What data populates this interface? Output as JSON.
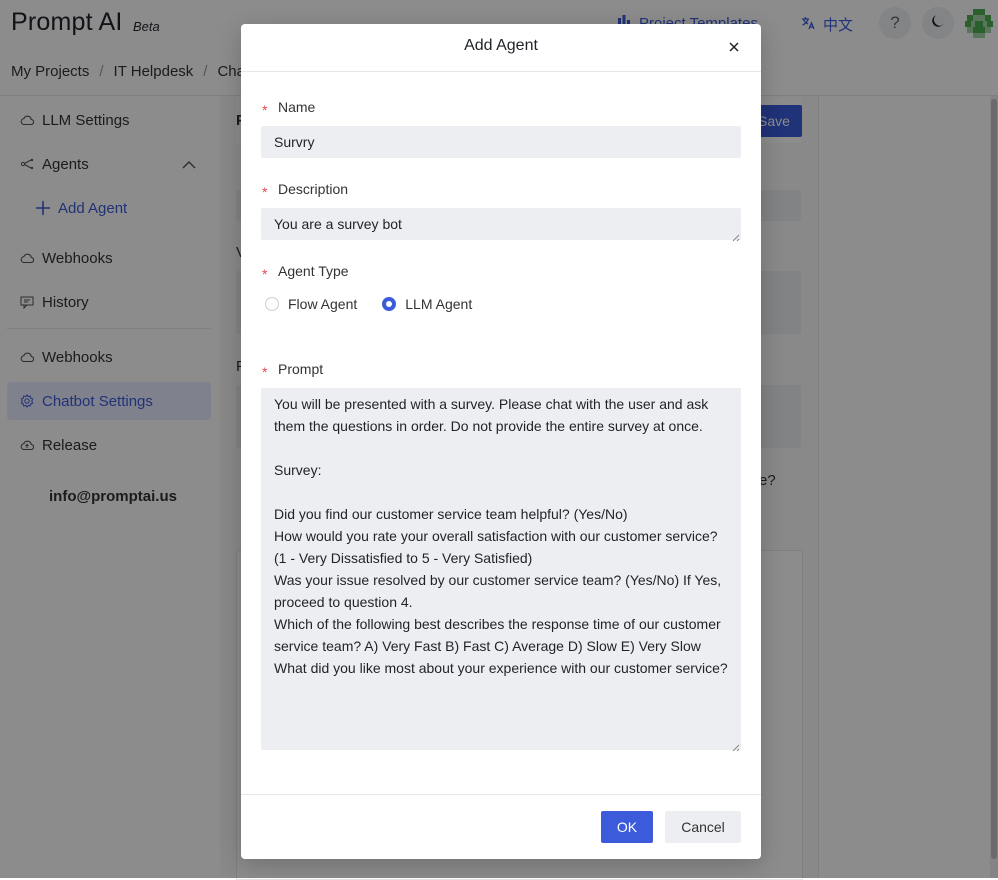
{
  "app": {
    "brand": "Prompt AI",
    "beta": "Beta",
    "project_templates": "Project Templates",
    "language": "中文",
    "help_icon": "?"
  },
  "breadcrumb": [
    "My Projects",
    "IT Helpdesk",
    "Chatb"
  ],
  "sidebar": {
    "items": [
      {
        "label": "LLM Settings",
        "icon": "cloud-icon"
      },
      {
        "label": "Agents",
        "icon": "agents-icon"
      },
      {
        "label": "Add Agent",
        "icon": "plus-icon"
      },
      {
        "label": "Webhooks",
        "icon": "cloud-icon"
      },
      {
        "label": "History",
        "icon": "history-icon"
      },
      {
        "label": "Webhooks",
        "icon": "cloud-icon"
      },
      {
        "label": "Chatbot Settings",
        "icon": "settings-icon"
      },
      {
        "label": "Release",
        "icon": "release-icon"
      }
    ],
    "email": "info@promptai.us"
  },
  "main": {
    "save": "Save",
    "letters": [
      "P",
      "V",
      "F"
    ],
    "trailing": "e?"
  },
  "modal": {
    "title": "Add Agent",
    "name_label": "Name",
    "name_value": "Survry",
    "description_label": "Description",
    "description_value": "You are a survey bot",
    "agent_type_label": "Agent Type",
    "agent_types": [
      "Flow Agent",
      "LLM Agent"
    ],
    "agent_type_selected": "LLM Agent",
    "prompt_label": "Prompt",
    "prompt_value": "You will be presented with a survey. Please chat with the user and ask them the questions in order. Do not provide the entire survey at once.\n\nSurvey:\n\nDid you find our customer service team helpful? (Yes/No)\nHow would you rate your overall satisfaction with our customer service? (1 - Very Dissatisfied to 5 - Very Satisfied)\nWas your issue resolved by our customer service team? (Yes/No) If Yes, proceed to question 4.\nWhich of the following best describes the response time of our customer service team? A) Very Fast B) Fast C) Average D) Slow E) Very Slow\nWhat did you like most about your experience with our customer service?",
    "ok": "OK",
    "cancel": "Cancel"
  },
  "colors": {
    "accent": "#3b5bdb",
    "required": "#e5484d",
    "input_bg": "#eceef1"
  }
}
